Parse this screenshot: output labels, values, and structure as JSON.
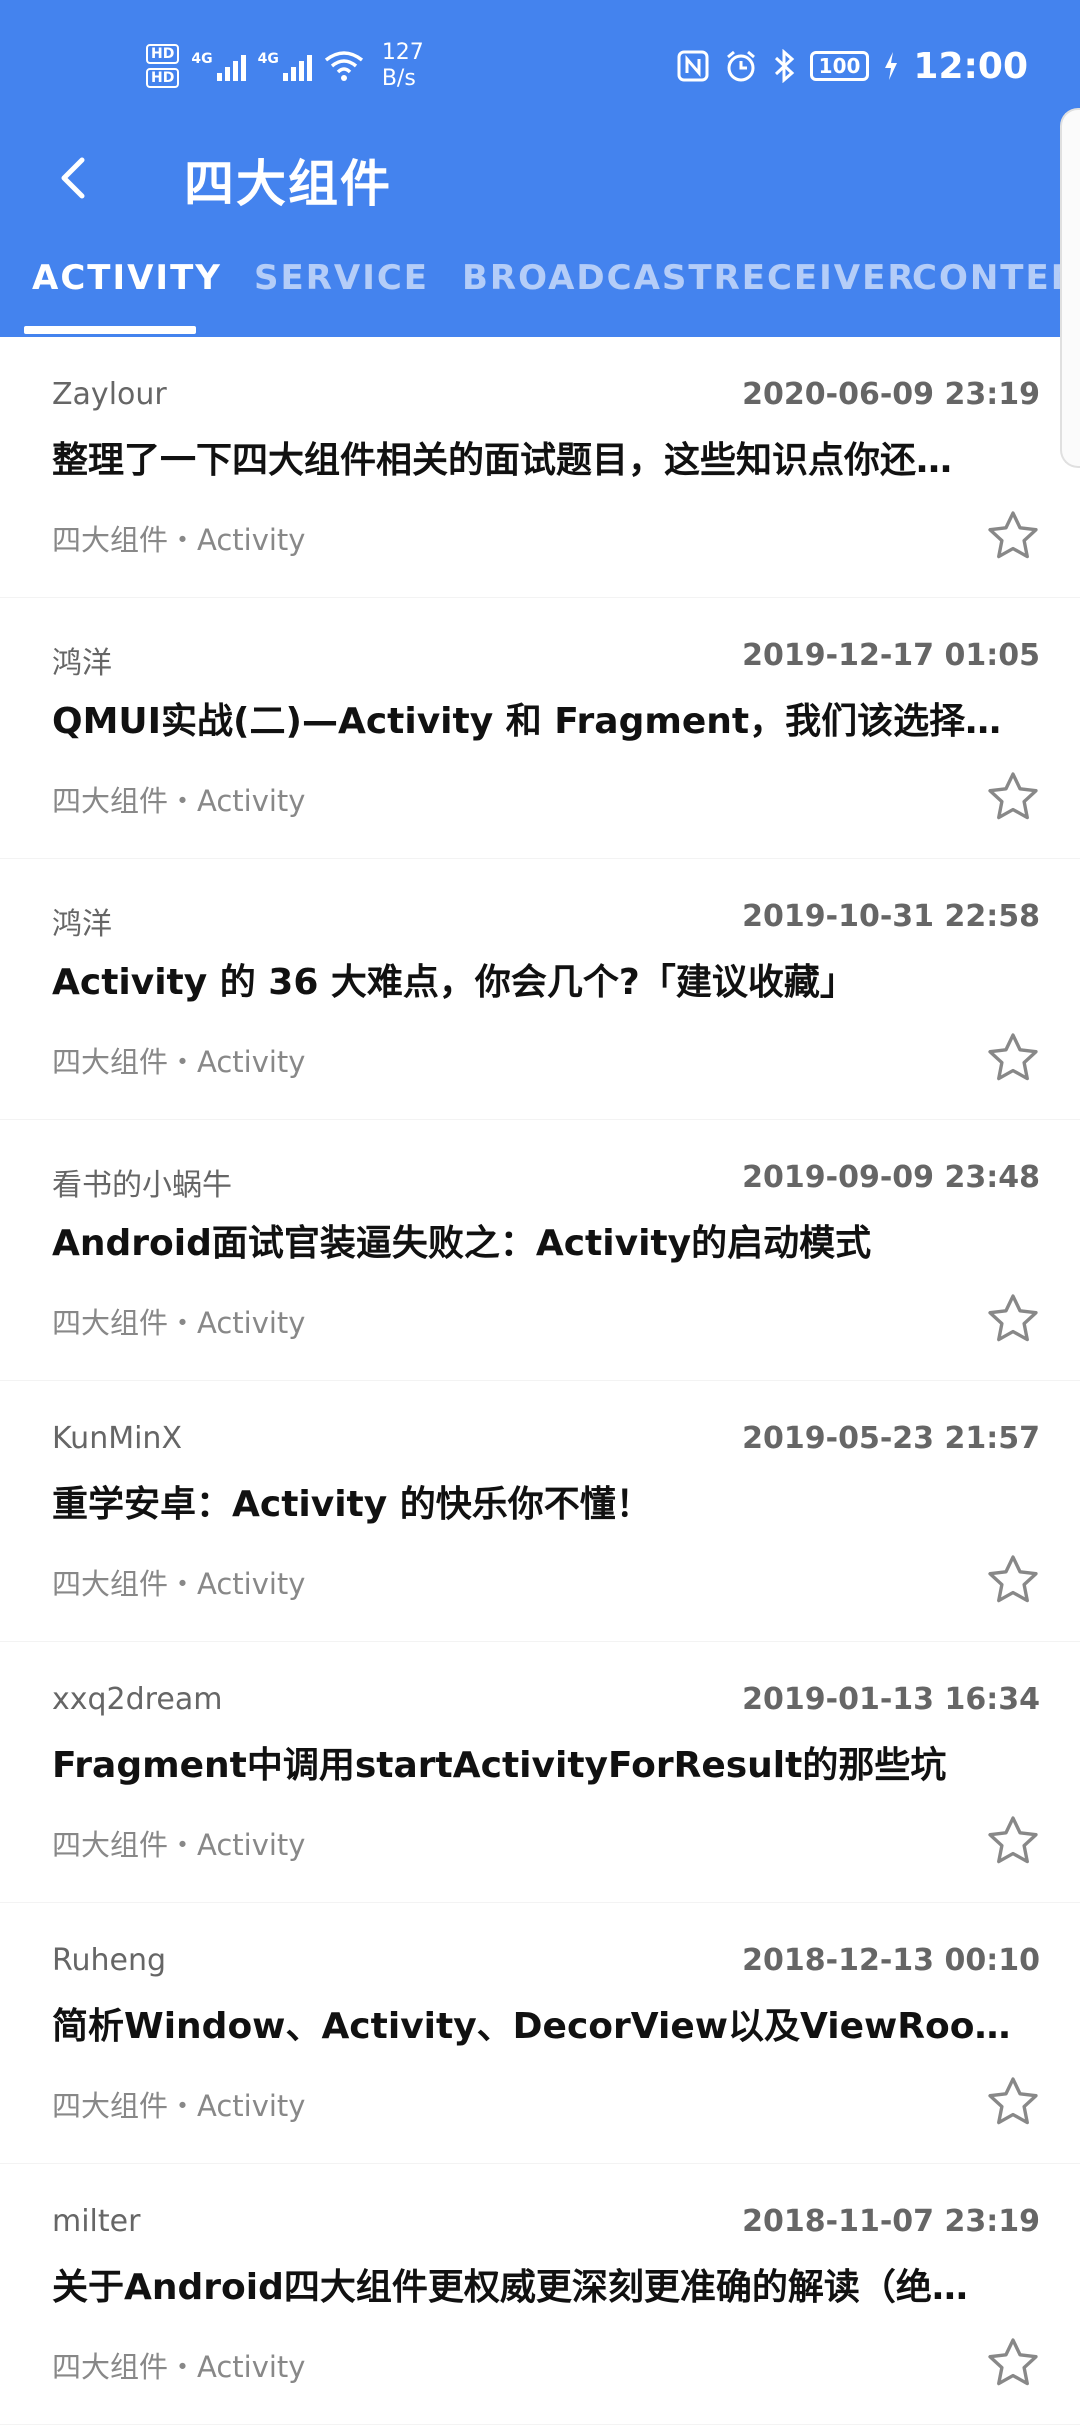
{
  "status_bar": {
    "hd1": "HD",
    "hd2": "HD",
    "net1": "4G",
    "net2": "4G",
    "speed_value": "127",
    "speed_unit": "B/s",
    "battery": "100",
    "time": "12:00",
    "icons": [
      "nfc-icon",
      "alarm-icon",
      "bluetooth-icon",
      "charging-icon"
    ]
  },
  "header": {
    "title": "四大组件",
    "back_icon": "chevron-left-icon"
  },
  "tabs": [
    {
      "label": "ACTIVITY",
      "active": true
    },
    {
      "label": "SERVICE",
      "active": false
    },
    {
      "label": "BROADCASTRECEIVER",
      "active": false
    },
    {
      "label": "CONTENT",
      "active": false
    }
  ],
  "articles": [
    {
      "author": "Zaylour",
      "date": "2020-06-09 23:19",
      "title": "整理了一下四大组件相关的面试题目，这些知识点你还…",
      "tags": "四大组件・Activity"
    },
    {
      "author": "鸿洋",
      "date": "2019-12-17 01:05",
      "title": "QMUI实战(二)—Activity 和 Fragment，我们该选择谁?",
      "tags": "四大组件・Activity"
    },
    {
      "author": "鸿洋",
      "date": "2019-10-31 22:58",
      "title": "Activity 的 36 大难点，你会几个?「建议收藏」",
      "tags": "四大组件・Activity"
    },
    {
      "author": "看书的小蜗牛",
      "date": "2019-09-09 23:48",
      "title": "Android面试官装逼失败之：Activity的启动模式",
      "tags": "四大组件・Activity"
    },
    {
      "author": " KunMinX",
      "date": "2019-05-23 21:57",
      "title": "重学安卓：Activity 的快乐你不懂！",
      "tags": "四大组件・Activity"
    },
    {
      "author": "xxq2dream",
      "date": "2019-01-13 16:34",
      "title": "Fragment中调用startActivityForResult的那些坑",
      "tags": "四大组件・Activity"
    },
    {
      "author": "Ruheng",
      "date": "2018-12-13 00:10",
      "title": "简析Window、Activity、DecorView以及ViewRoot之间…",
      "tags": "四大组件・Activity"
    },
    {
      "author": "milter",
      "date": "2018-11-07 23:19",
      "title": "关于Android四大组件更权威更深刻更准确的解读（绝…",
      "tags": "四大组件・Activity"
    }
  ],
  "colors": {
    "primary": "#4483ee",
    "author": "#666666",
    "tag": "#888888"
  }
}
